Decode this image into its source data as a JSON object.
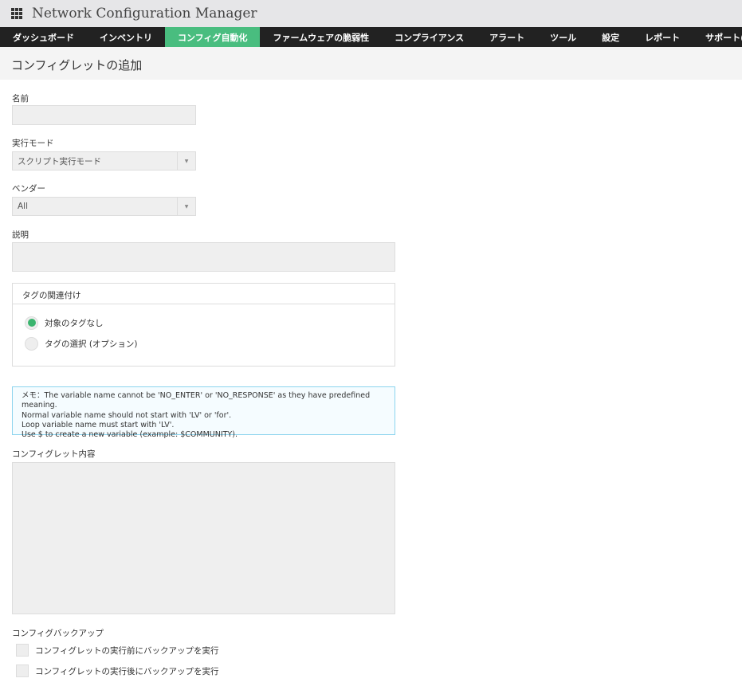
{
  "app": {
    "title": "Network Configuration Manager"
  },
  "nav": [
    "ダッシュボード",
    "インベントリ",
    "コンフィグ自動化",
    "ファームウェアの脆弱性",
    "コンプライアンス",
    "アラート",
    "ツール",
    "設定",
    "レポート",
    "サポート(米国)"
  ],
  "page": {
    "title": "コンフィグレットの追加"
  },
  "form": {
    "name_label": "名前",
    "name_value": "",
    "mode_label": "実行モード",
    "mode_value": "スクリプト実行モード",
    "vendor_label": "ベンダー",
    "vendor_value": "All",
    "desc_label": "説明",
    "desc_value": "",
    "tag_header": "タグの関連付け",
    "tag_options": [
      "対象のタグなし",
      "タグの選択 (オプション)"
    ],
    "tag_selected": 0,
    "note": [
      "メモ：The variable name cannot be 'NO_ENTER' or 'NO_RESPONSE' as they have predefined meaning.",
      "Normal variable name should not start with 'LV' or 'for'.",
      "Loop variable name must start with 'LV'.",
      "Use $ to create a new variable (example: $COMMUNITY)."
    ],
    "content_label": "コンフィグレット内容",
    "content_value": "",
    "backup_label": "コンフィグバックアップ",
    "backup_options": [
      "コンフィグレットの実行前にバックアップを実行",
      "コンフィグレットの実行後にバックアップを実行"
    ]
  }
}
